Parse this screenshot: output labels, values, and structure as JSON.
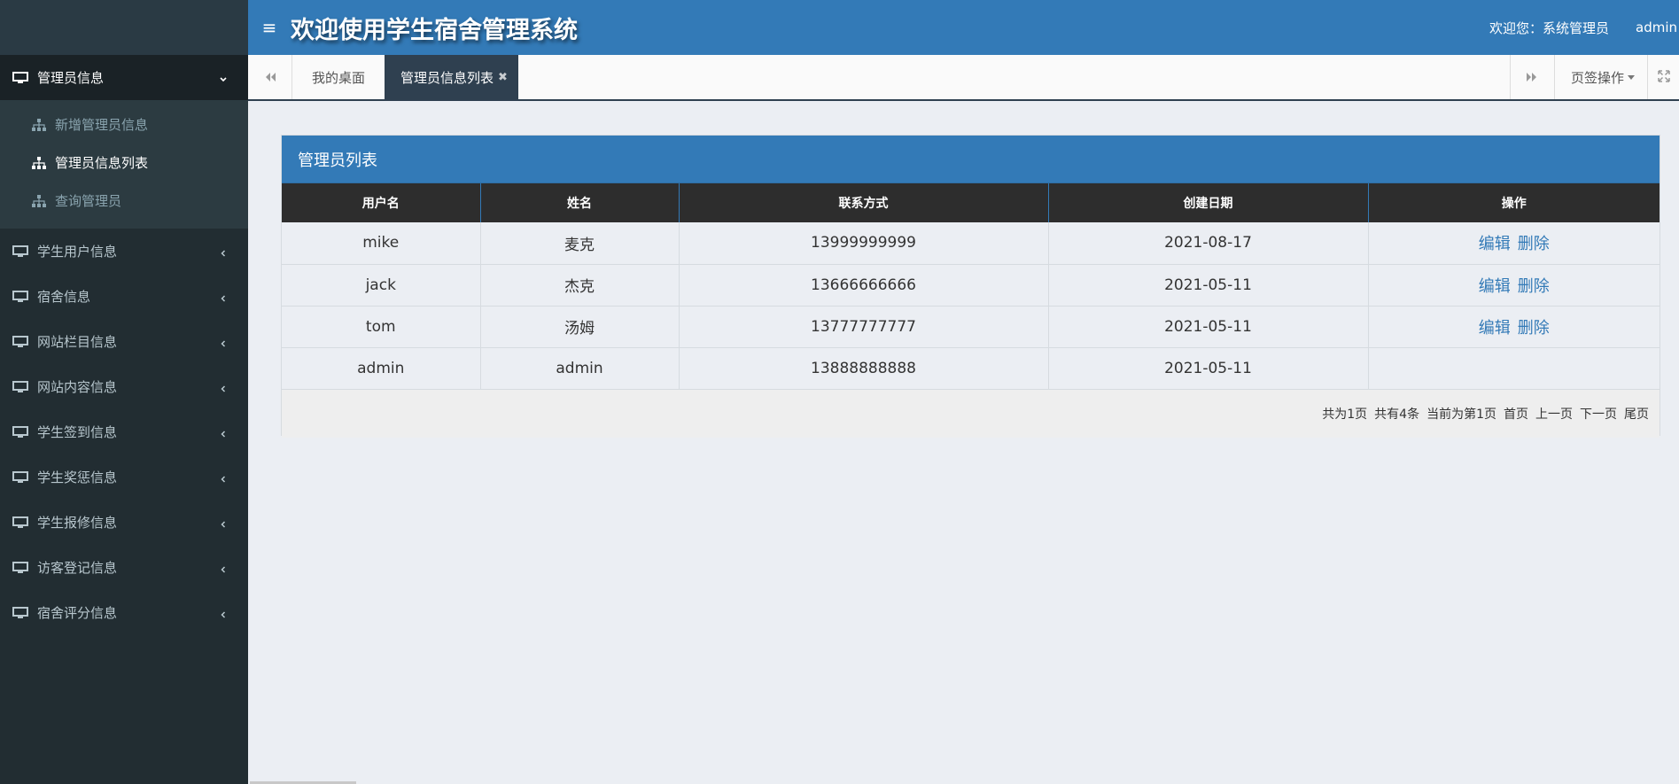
{
  "header": {
    "title": "欢迎使用学生宿舍管理系统",
    "welcome": "欢迎您：系统管理员",
    "username": "admin"
  },
  "sidebar": {
    "groups": [
      {
        "label": "管理员信息",
        "expanded": true,
        "items": [
          {
            "label": "新增管理员信息"
          },
          {
            "label": "管理员信息列表",
            "active": true
          },
          {
            "label": "查询管理员"
          }
        ]
      },
      {
        "label": "学生用户信息"
      },
      {
        "label": "宿舍信息"
      },
      {
        "label": "网站栏目信息"
      },
      {
        "label": "网站内容信息"
      },
      {
        "label": "学生签到信息"
      },
      {
        "label": "学生奖惩信息"
      },
      {
        "label": "学生报修信息"
      },
      {
        "label": "访客登记信息"
      },
      {
        "label": "宿舍评分信息"
      }
    ]
  },
  "tabs": {
    "items": [
      {
        "label": "我的桌面"
      },
      {
        "label": "管理员信息列表",
        "active": true
      }
    ],
    "ops_label": "页签操作"
  },
  "panel": {
    "title": "管理员列表",
    "columns": [
      "用户名",
      "姓名",
      "联系方式",
      "创建日期",
      "操作"
    ],
    "rows": [
      {
        "username": "mike",
        "name": "麦克",
        "phone": "13999999999",
        "date": "2021-08-17",
        "edit": "编辑",
        "delete": "删除"
      },
      {
        "username": "jack",
        "name": "杰克",
        "phone": "13666666666",
        "date": "2021-05-11",
        "edit": "编辑",
        "delete": "删除"
      },
      {
        "username": "tom",
        "name": "汤姆",
        "phone": "13777777777",
        "date": "2021-05-11",
        "edit": "编辑",
        "delete": "删除"
      },
      {
        "username": "admin",
        "name": "admin",
        "phone": "13888888888",
        "date": "2021-05-11",
        "edit": "",
        "delete": ""
      }
    ],
    "pager": {
      "total_pages": "共为1页",
      "total_records": "共有4条",
      "current": "当前为第1页",
      "first": "首页",
      "prev": "上一页",
      "next": "下一页",
      "last": "尾页"
    }
  },
  "colors": {
    "primary": "#337ab7",
    "sidebar_bg": "#222d32",
    "table_header": "#2d2d2d",
    "active_tab": "#2f4050"
  }
}
